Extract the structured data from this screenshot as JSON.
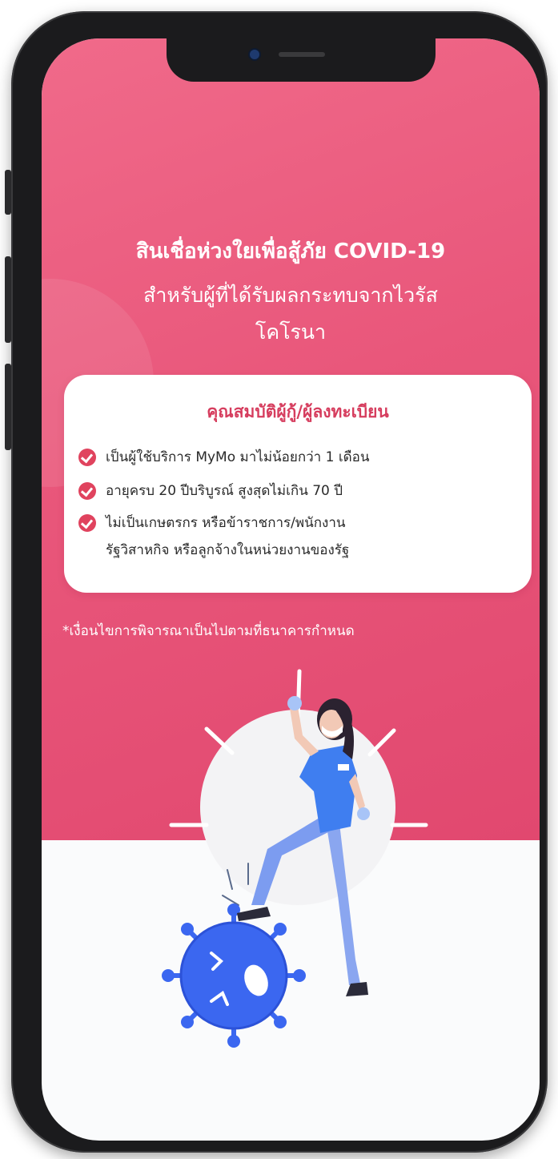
{
  "headline": {
    "title": "สินเชื่อห่วงใยเพื่อสู้ภัย COVID-19",
    "subtitle_line1": "สำหรับผู้ที่ได้รับผลกระทบจากไวรัส",
    "subtitle_line2": "โคโรนา"
  },
  "eligibility": {
    "title": "คุณสมบัติผู้กู้/ผู้ลงทะเบียน",
    "items": [
      {
        "text": "เป็นผู้ใช้บริการ MyMo มาไม่น้อยกว่า 1 เดือน",
        "icon": "check-circle-icon"
      },
      {
        "text": "อายุครบ 20 ปีบริบูรณ์ สูงสุดไม่เกิน 70 ปี",
        "icon": "check-circle-icon"
      },
      {
        "text": "ไม่เป็นเกษตรกร หรือข้าราชการ/พนักงาน",
        "text2": "รัฐวิสาหกิจ หรือลูกจ้างในหน่วยงานของรัฐ",
        "icon": "check-circle-icon"
      }
    ]
  },
  "footnote": "*เงื่อนไขการพิจารณาเป็นไปตามที่ธนาคารกำหนด",
  "illustration": {
    "name": "nurse-stepping-on-virus-illustration"
  },
  "colors": {
    "accent_pink": "#e9577b",
    "title_red": "#d63d5e",
    "check_red": "#e0435e",
    "uniform_blue": "#3f7ef0",
    "virus_blue": "#3b67f0"
  }
}
